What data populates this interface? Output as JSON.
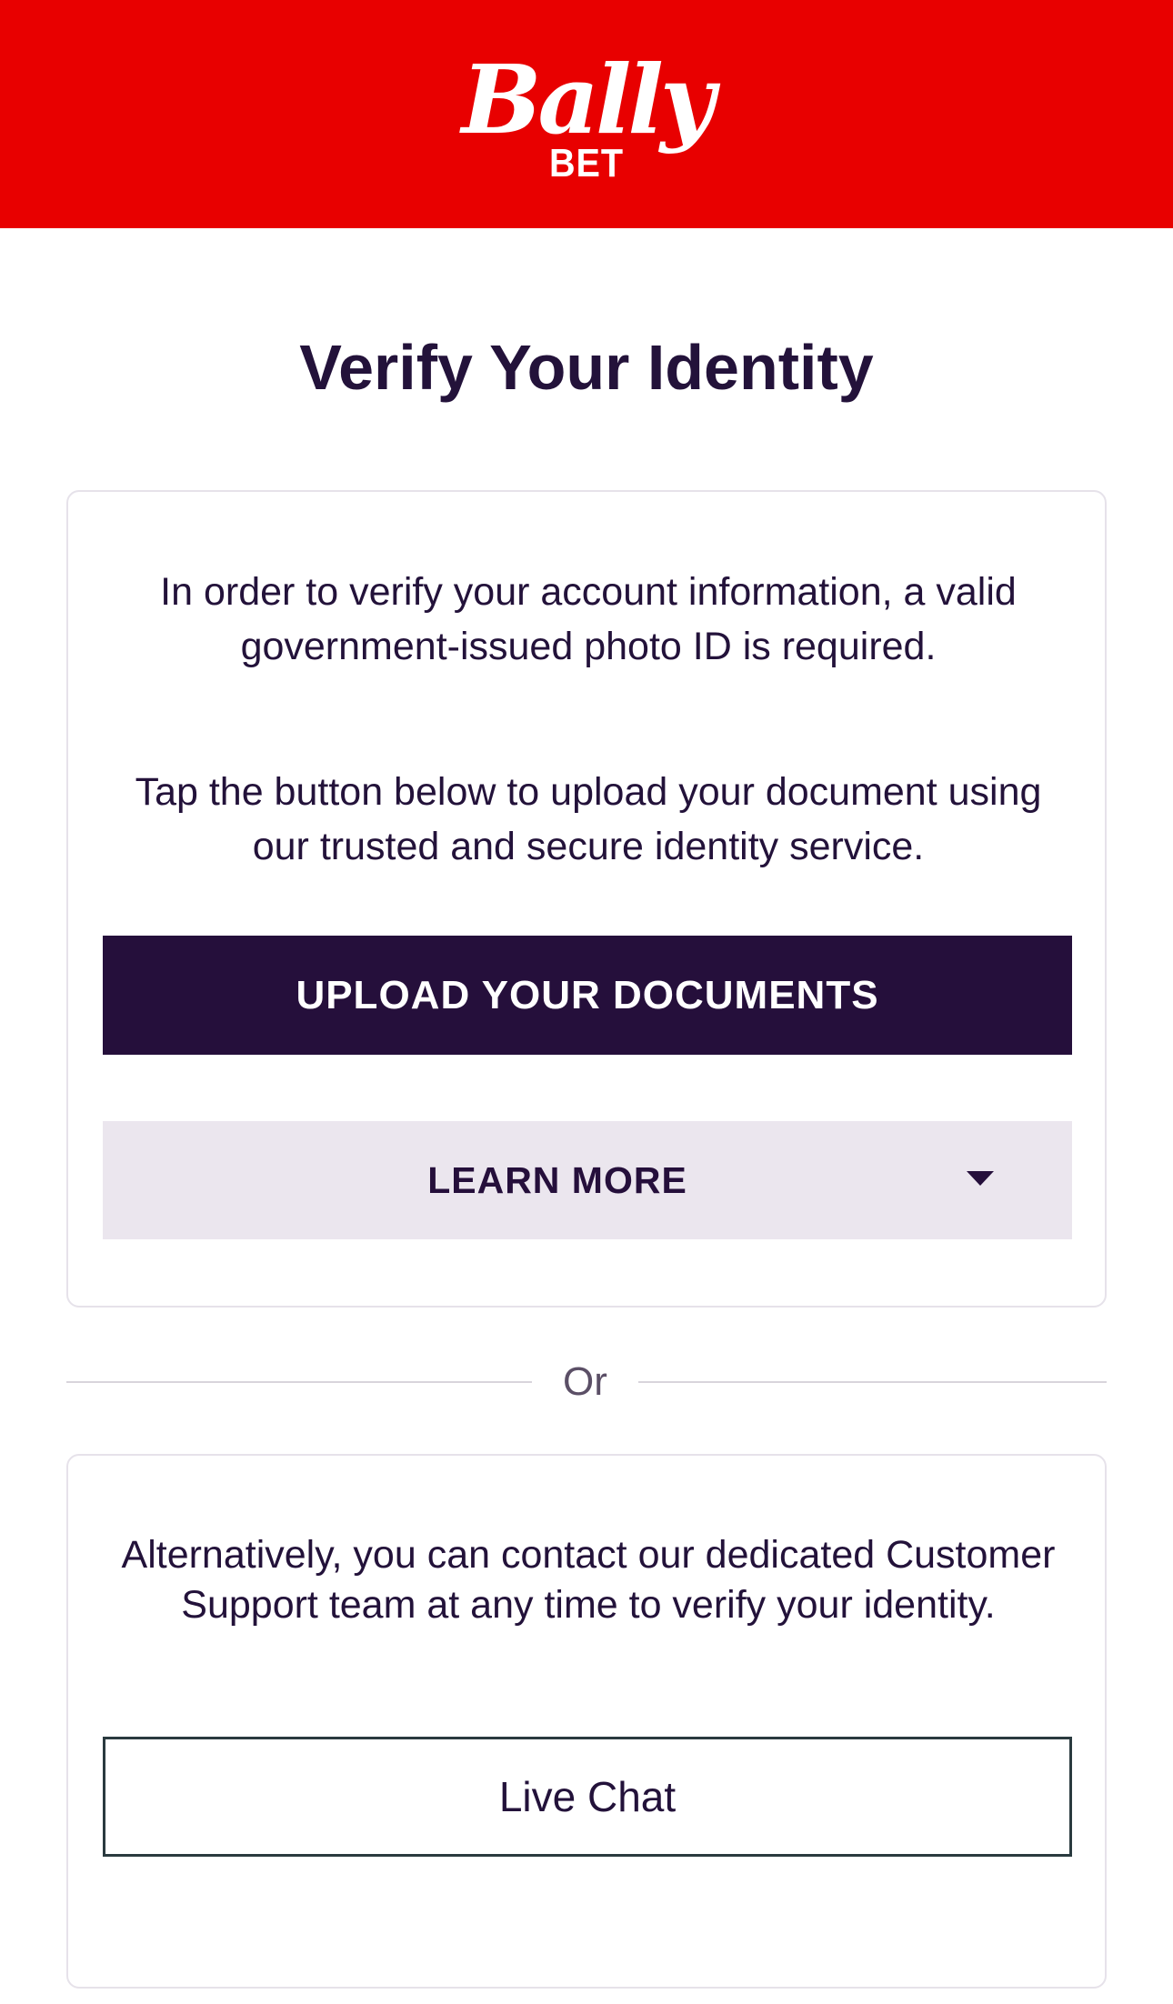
{
  "header": {
    "logo_script": "Bally",
    "logo_sub": "BET",
    "brand_color": "#e80000"
  },
  "title": "Verify Your Identity",
  "verify_card": {
    "para1": "In order to verify your account information, a valid government-issued photo ID is required.",
    "para2": "Tap the button below to upload your document using our trusted and secure identity service.",
    "upload_button": "UPLOAD YOUR DOCUMENTS",
    "learn_more_button": "LEARN MORE",
    "learn_more_icon": "chevron-down-icon"
  },
  "divider": {
    "text": "Or"
  },
  "support_card": {
    "para": "Alternatively, you can contact our dedicated Customer Support team at any time to verify your identity.",
    "live_chat_button": "Live Chat"
  },
  "colors": {
    "primary_dark": "#250f3b",
    "secondary_bg": "#ebe6ee"
  }
}
